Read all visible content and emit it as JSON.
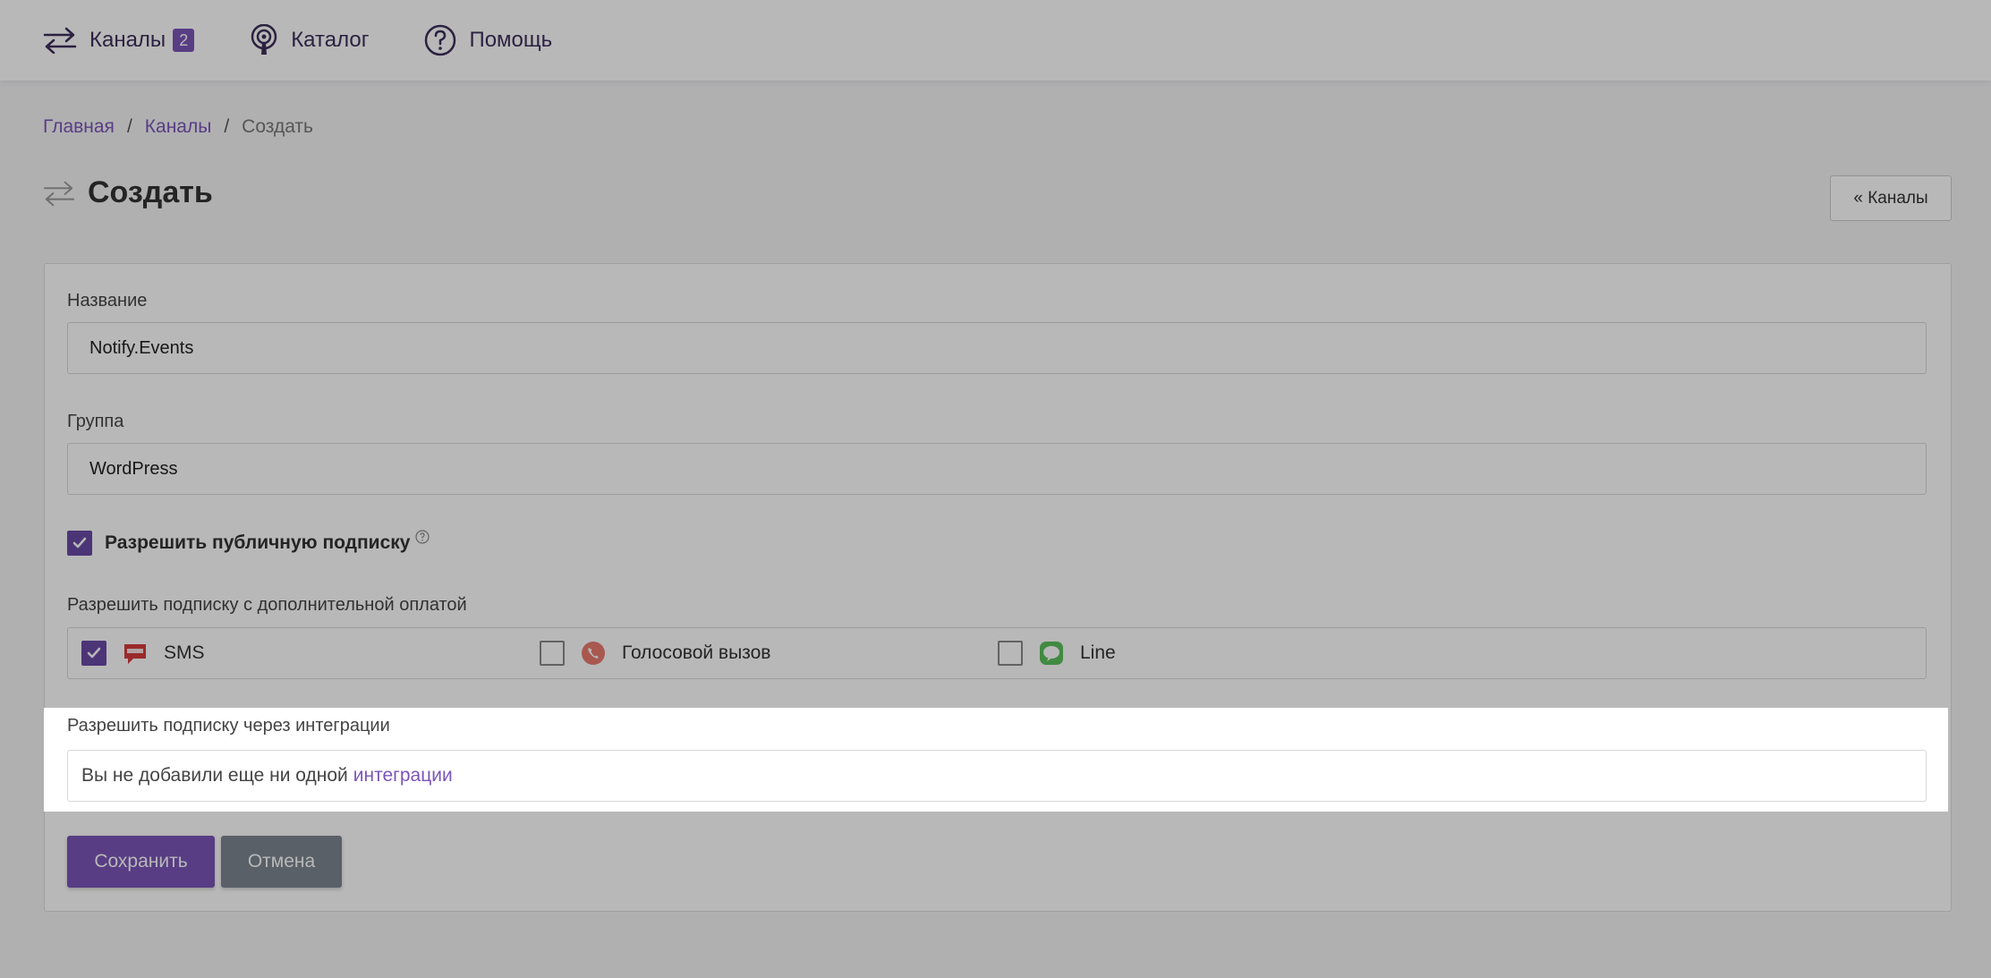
{
  "nav": {
    "channels_label": "Каналы",
    "channels_count": "2",
    "catalog_label": "Каталог",
    "help_label": "Помощь"
  },
  "breadcrumb": {
    "home": "Главная",
    "sep1": "/",
    "channels": "Каналы",
    "sep2": "/",
    "current": "Создать"
  },
  "page": {
    "title": "Создать",
    "back_button": "« Каналы"
  },
  "form": {
    "name_label": "Название",
    "name_value": "Notify.Events",
    "group_label": "Группа",
    "group_value": "WordPress",
    "public_label": "Разрешить публичную подписку",
    "paid_label": "Разрешить подписку с дополнительной оплатой",
    "paid_options": [
      {
        "label": "SMS",
        "checked": true,
        "icon": "sms-icon"
      },
      {
        "label": "Голосовой вызов",
        "checked": false,
        "icon": "phone-icon"
      },
      {
        "label": "Line",
        "checked": false,
        "icon": "line-icon"
      }
    ],
    "integrations_label": "Разрешить подписку через интеграции",
    "integrations_text": "Вы не добавили еще ни одной",
    "integrations_link": "интеграции",
    "save_button": "Сохранить",
    "cancel_button": "Отмена"
  },
  "colors": {
    "accent": "#7b55b8",
    "cancel": "#7d8690"
  }
}
